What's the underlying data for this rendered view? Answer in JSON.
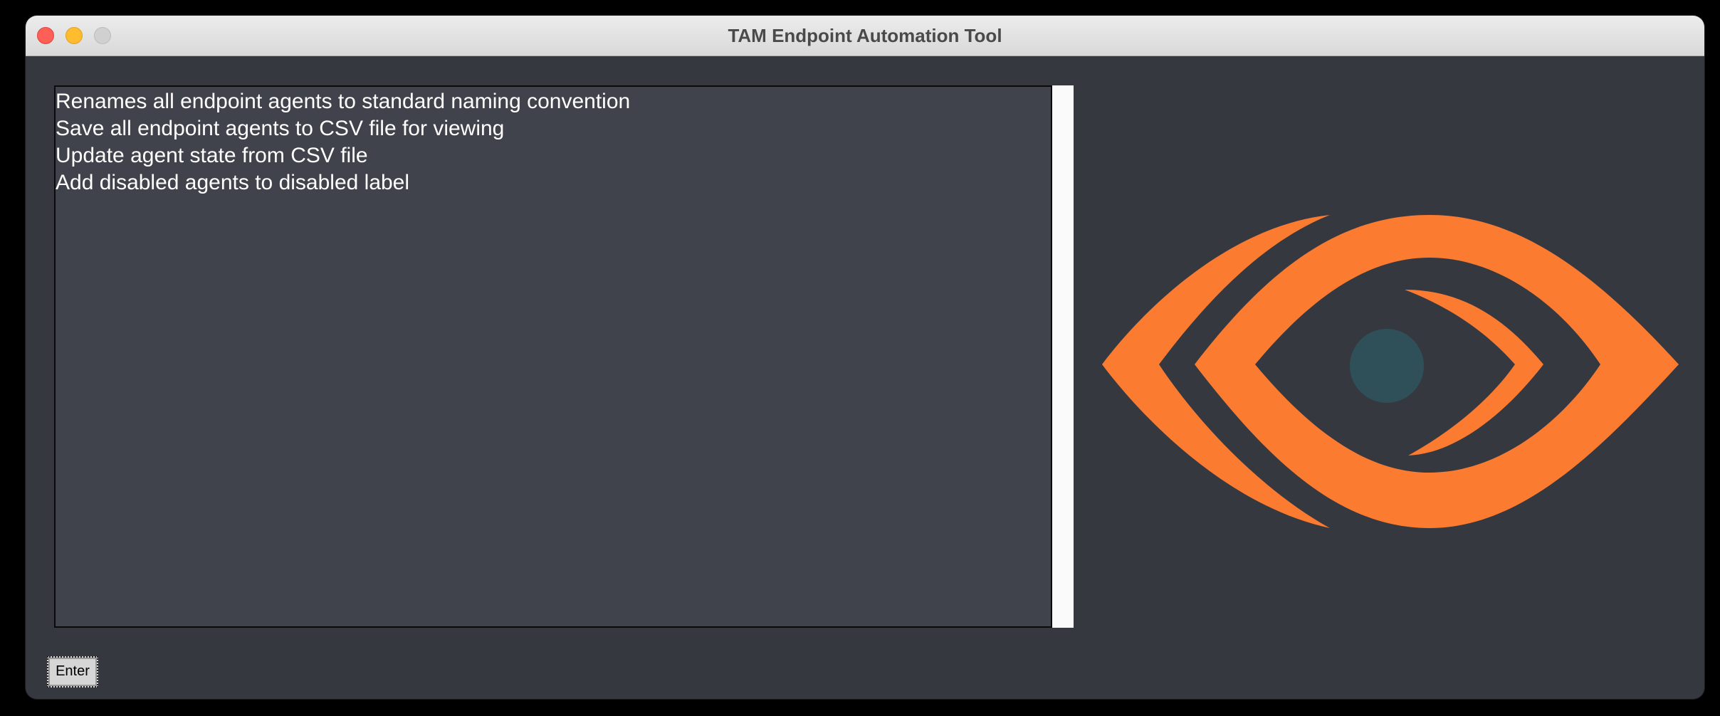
{
  "window": {
    "title": "TAM Endpoint Automation Tool"
  },
  "listbox": {
    "items": [
      "Renames all endpoint agents to standard naming convention",
      "Save all endpoint agents to CSV file for viewing",
      "Update agent state from CSV file",
      "Add disabled agents to disabled label"
    ]
  },
  "logo": {
    "icon": "eye-logo-icon",
    "primary_color": "#fb7b31",
    "pupil_color": "#2f5058"
  },
  "buttons": {
    "enter_label": "Enter"
  }
}
